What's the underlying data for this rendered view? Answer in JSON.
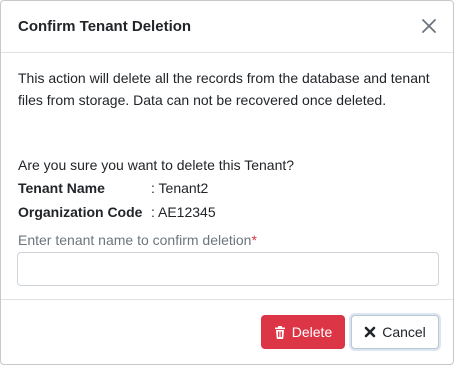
{
  "dialog": {
    "title": "Confirm Tenant Deletion",
    "message": "This action will delete all the records from the database and tenant files from storage. Data can not be recovered once deleted.",
    "question": "Are you sure you want to delete this Tenant?",
    "details": [
      {
        "label": "Tenant Name",
        "value": ": Tenant2"
      },
      {
        "label": "Organization Code",
        "value": ": AE12345"
      }
    ],
    "confirm_label": "Enter tenant name to confirm deletion",
    "required_mark": "*",
    "confirm_input_value": "",
    "delete_label": "Delete",
    "cancel_label": "Cancel"
  },
  "icons": {
    "close": "close-icon",
    "delete": "trash-icon",
    "cancel": "x-icon"
  },
  "colors": {
    "danger": "#dc3545",
    "border": "#dee2e6",
    "muted_text": "#6c757d"
  }
}
